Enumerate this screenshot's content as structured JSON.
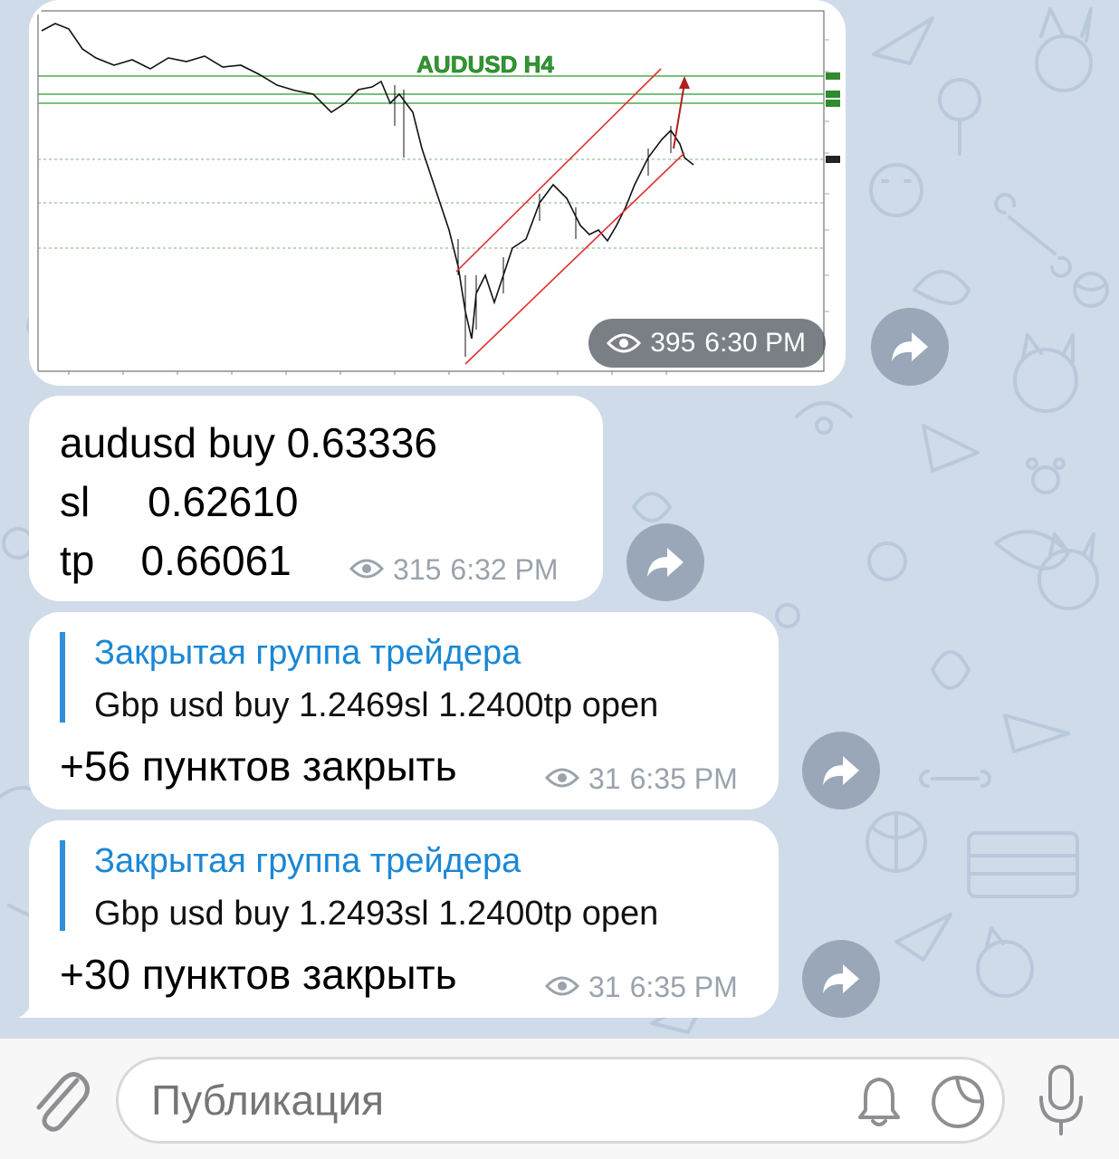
{
  "chat": {
    "messages": [
      {
        "type": "photo",
        "chart_title": "AUDUSD H4",
        "views": "395",
        "time": "6:30 PM"
      },
      {
        "type": "text",
        "lines": [
          "audusd buy 0.63336",
          "sl     0.62610",
          "tp    0.66061"
        ],
        "views": "315",
        "time": "6:32 PM"
      },
      {
        "type": "reply",
        "quote_author": "Закрытая группа трейдера",
        "quote_text": "Gbp usd buy 1.2469sl 1.2400tp open",
        "text": "+56 пунктов закрыть",
        "views": "31",
        "time": "6:35 PM"
      },
      {
        "type": "reply",
        "quote_author": "Закрытая группа трейдера",
        "quote_text": "Gbp usd buy 1.2493sl 1.2400tp open",
        "text": "+30 пунктов закрыть",
        "views": "31",
        "time": "6:35 PM"
      }
    ]
  },
  "composer": {
    "placeholder": "Публикация"
  },
  "icons": {
    "attach": "paperclip-icon",
    "notifications": "bell-icon",
    "sticker": "sticker-icon",
    "voice": "microphone-icon",
    "views": "eye-icon",
    "share": "share-arrow-icon"
  },
  "colors": {
    "background": "#cfdbe8",
    "bubble": "#ffffff",
    "accent": "#1a87d6",
    "chart_title": "#2e9a2e",
    "channel_lines": "#e03030"
  }
}
